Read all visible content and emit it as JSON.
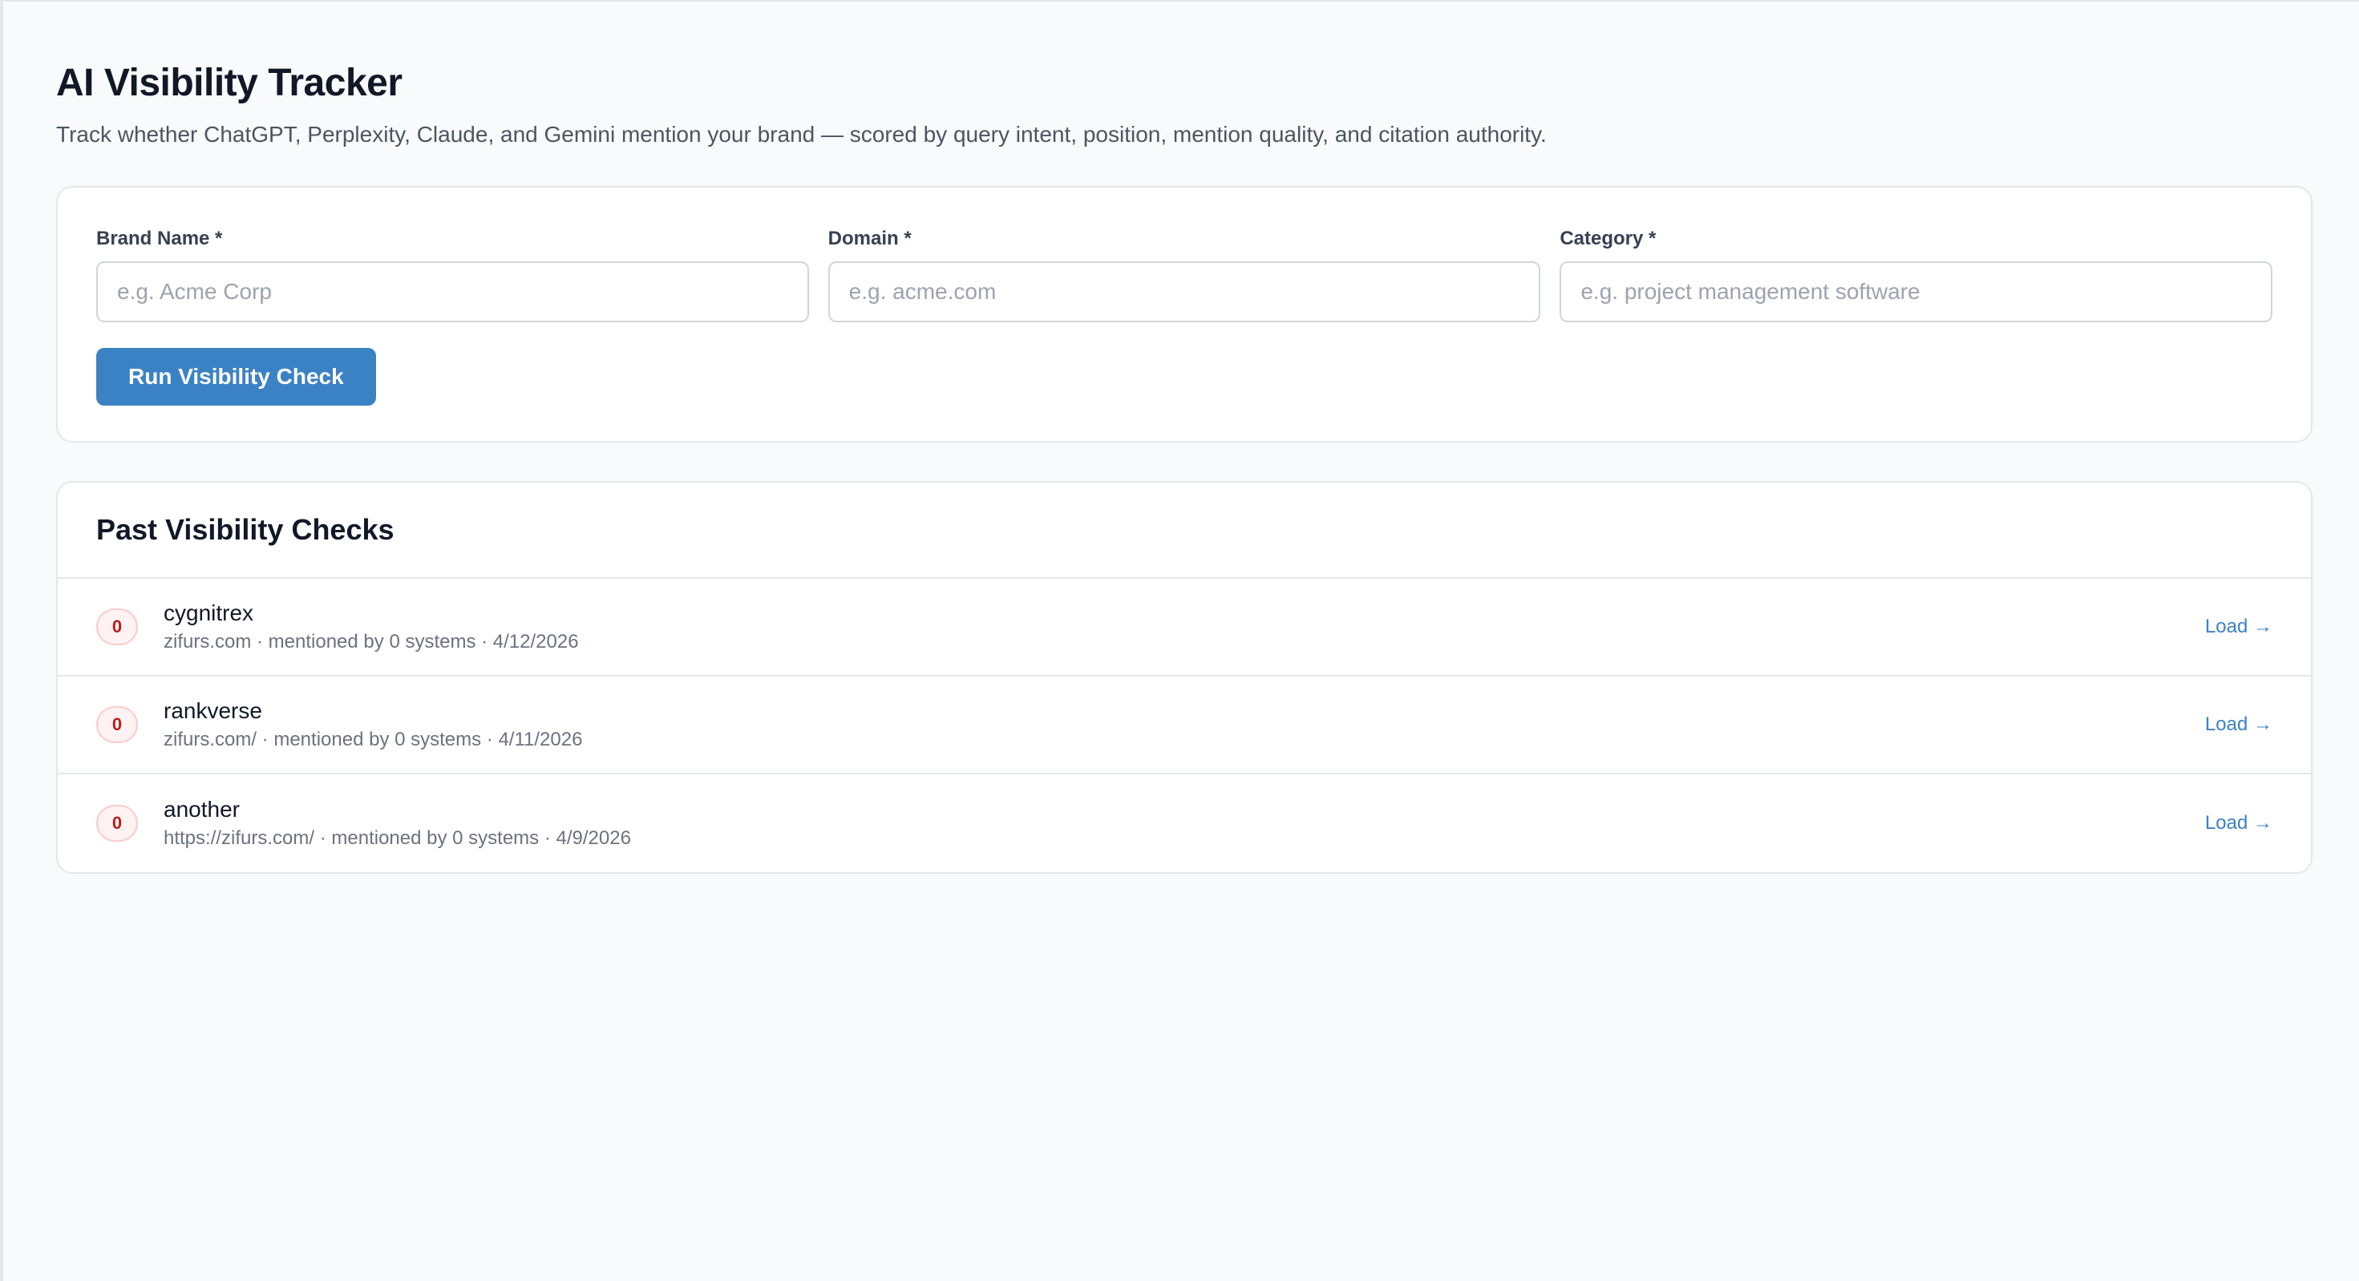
{
  "header": {
    "title": "AI Visibility Tracker",
    "subtitle": "Track whether ChatGPT, Perplexity, Claude, and Gemini mention your brand — scored by query intent, position, mention quality, and citation authority."
  },
  "form": {
    "brand": {
      "label": "Brand Name *",
      "placeholder": "e.g. Acme Corp",
      "value": ""
    },
    "domain": {
      "label": "Domain *",
      "placeholder": "e.g. acme.com",
      "value": ""
    },
    "category": {
      "label": "Category *",
      "placeholder": "e.g. project management software",
      "value": ""
    },
    "submit_label": "Run Visibility Check"
  },
  "history": {
    "title": "Past Visibility Checks",
    "items": [
      {
        "score": "0",
        "name": "cygnitrex",
        "meta": "zifurs.com · mentioned by 0 systems · 4/12/2026",
        "action": "Load →"
      },
      {
        "score": "0",
        "name": "rankverse",
        "meta": "zifurs.com/ · mentioned by 0 systems · 4/11/2026",
        "action": "Load →"
      },
      {
        "score": "0",
        "name": "another",
        "meta": "https://zifurs.com/ · mentioned by 0 systems · 4/9/2026",
        "action": "Load →"
      }
    ]
  },
  "colors": {
    "accent": "#3b82c4",
    "score_low": "#b91c1c",
    "background": "#f9fafb"
  }
}
